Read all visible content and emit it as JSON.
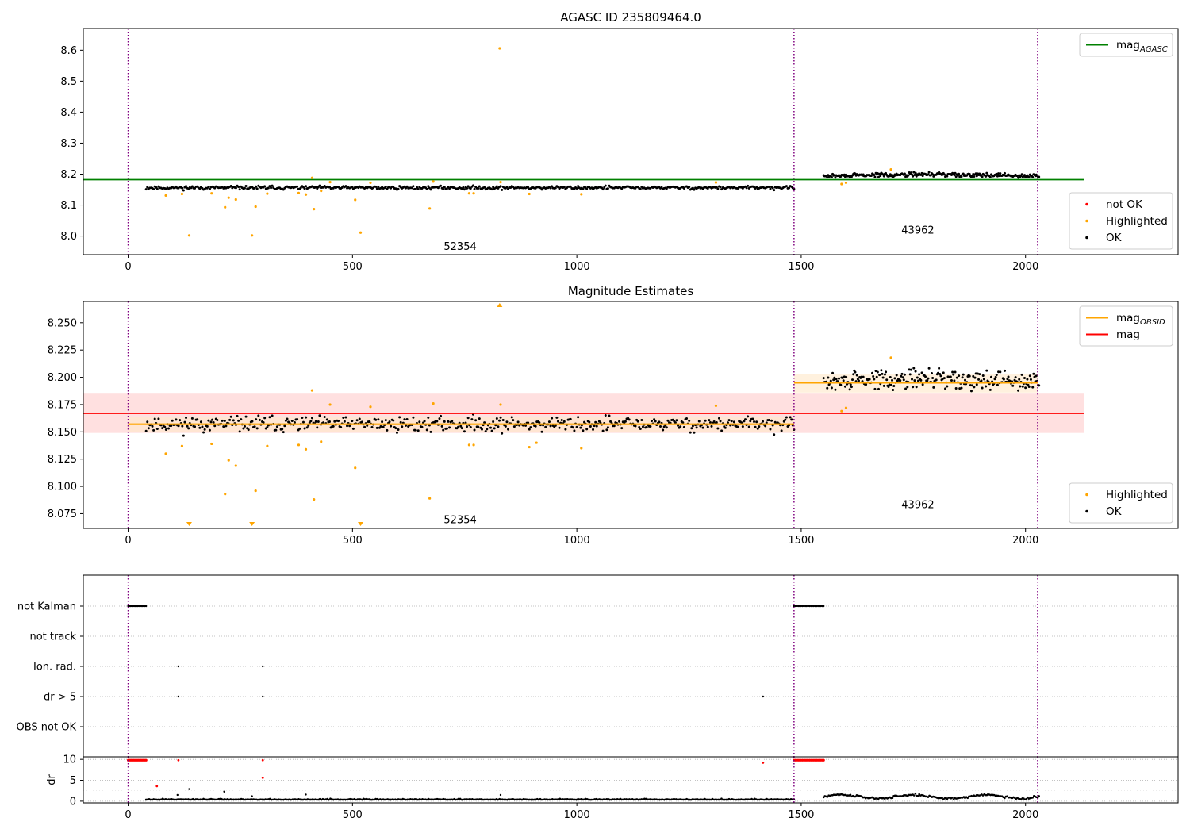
{
  "figure": {
    "colors": {
      "ok": "#000000",
      "highlighted": "#ffa500",
      "not_ok": "#ff0000",
      "mag_agasc": "#008000",
      "mag": "#ff0000",
      "mag_obsid": "#ffa500",
      "obsid_boundary": "#800080",
      "band_red": "#ffd6d6",
      "band_orange": "#ffe8c8",
      "grid": "#b0b0b0"
    }
  },
  "chart_data": [
    {
      "id": "top",
      "type": "scatter",
      "title": "AGASC ID 235809464.0",
      "xlim": [
        -100,
        2340
      ],
      "ylim": [
        7.94,
        8.67
      ],
      "xticks": [
        0,
        500,
        1000,
        1500,
        2000
      ],
      "yticks": [
        8.0,
        8.1,
        8.2,
        8.3,
        8.4,
        8.5,
        8.6
      ],
      "yfmt": 1,
      "obsid_boundaries": [
        0,
        1484,
        2027
      ],
      "obsid_labels": [
        {
          "text": "52354",
          "x": 740,
          "y": 7.965
        },
        {
          "text": "43962",
          "x": 1760,
          "y": 8.018
        }
      ],
      "hlines": [
        {
          "name": "mag_agasc",
          "y": 8.182,
          "x": [
            -100,
            2130
          ],
          "color": "#008000"
        }
      ],
      "ok_segments": [
        {
          "x0": 40,
          "x1": 1484,
          "n": 520,
          "base": 8.156,
          "amp": 0.0055,
          "seed": 11
        },
        {
          "x0": 1550,
          "x1": 2030,
          "n": 240,
          "base": 8.193,
          "amp": 0.0065,
          "seed": 29,
          "trend": 0.006
        }
      ],
      "highlighted": [
        [
          84,
          8.131
        ],
        [
          120,
          8.136
        ],
        [
          136,
          8.002
        ],
        [
          186,
          8.138
        ],
        [
          216,
          8.093
        ],
        [
          224,
          8.124
        ],
        [
          240,
          8.118
        ],
        [
          276,
          8.002
        ],
        [
          284,
          8.095
        ],
        [
          310,
          8.137
        ],
        [
          380,
          8.139
        ],
        [
          396,
          8.134
        ],
        [
          410,
          8.188
        ],
        [
          414,
          8.087
        ],
        [
          430,
          8.146
        ],
        [
          450,
          8.174
        ],
        [
          506,
          8.117
        ],
        [
          518,
          8.011
        ],
        [
          540,
          8.172
        ],
        [
          672,
          8.089
        ],
        [
          680,
          8.176
        ],
        [
          760,
          8.138
        ],
        [
          770,
          8.138
        ],
        [
          828,
          8.606
        ],
        [
          830,
          8.174
        ],
        [
          894,
          8.136
        ],
        [
          1010,
          8.135
        ],
        [
          1310,
          8.173
        ],
        [
          1590,
          8.168
        ],
        [
          1600,
          8.172
        ],
        [
          1700,
          8.215
        ]
      ],
      "not_ok": [],
      "legends": [
        {
          "position": "upper-right",
          "items": [
            {
              "label": "mag",
              "sub": "AGASC",
              "kind": "line",
              "color": "#008000"
            }
          ]
        },
        {
          "position": "lower-right",
          "items": [
            {
              "label": "not OK",
              "kind": "dot",
              "color": "#ff0000"
            },
            {
              "label": "Highlighted",
              "kind": "dot",
              "color": "#ffa500"
            },
            {
              "label": "OK",
              "kind": "dot",
              "color": "#000000"
            }
          ]
        }
      ]
    },
    {
      "id": "middle",
      "type": "scatter",
      "title": "Magnitude Estimates",
      "xlim": [
        -100,
        2340
      ],
      "ylim": [
        8.0615,
        8.2695
      ],
      "xticks": [
        0,
        500,
        1000,
        1500,
        2000
      ],
      "yticks": [
        8.075,
        8.1,
        8.125,
        8.15,
        8.175,
        8.2,
        8.225,
        8.25
      ],
      "yfmt": 3,
      "obsid_boundaries": [
        0,
        1484,
        2027
      ],
      "obsid_labels": [
        {
          "text": "52354",
          "x": 740,
          "y": 8.069
        },
        {
          "text": "43962",
          "x": 1760,
          "y": 8.083
        }
      ],
      "bands": [
        {
          "x": [
            -100,
            2130
          ],
          "y": [
            8.149,
            8.185
          ],
          "color": "#ffd6d6"
        },
        {
          "x": [
            0,
            1484
          ],
          "y": [
            8.15,
            8.164
          ],
          "color": "#ffe8c8"
        },
        {
          "x": [
            1484,
            2027
          ],
          "y": [
            8.186,
            8.203
          ],
          "color": "#ffe8c8"
        }
      ],
      "hlines": [
        {
          "name": "mag",
          "y": 8.167,
          "x": [
            -100,
            2130
          ],
          "color": "#ff0000"
        },
        {
          "name": "mag_obsid_1",
          "y": 8.157,
          "x": [
            0,
            1484
          ],
          "color": "#ffa500"
        },
        {
          "name": "mag_obsid_2",
          "y": 8.195,
          "x": [
            1484,
            2027
          ],
          "color": "#ffa500"
        }
      ],
      "ok_segments": [
        {
          "x0": 40,
          "x1": 1484,
          "n": 520,
          "base": 8.157,
          "amp": 0.0068,
          "seed": 11
        },
        {
          "x0": 1550,
          "x1": 2030,
          "n": 240,
          "base": 8.195,
          "amp": 0.0085,
          "seed": 29,
          "trend": 0.004
        }
      ],
      "highlighted": [
        [
          84,
          8.13
        ],
        [
          120,
          8.137
        ],
        [
          186,
          8.139
        ],
        [
          216,
          8.093
        ],
        [
          224,
          8.124
        ],
        [
          240,
          8.119
        ],
        [
          284,
          8.096
        ],
        [
          310,
          8.137
        ],
        [
          380,
          8.138
        ],
        [
          396,
          8.134
        ],
        [
          410,
          8.188
        ],
        [
          414,
          8.088
        ],
        [
          430,
          8.141
        ],
        [
          450,
          8.175
        ],
        [
          506,
          8.117
        ],
        [
          540,
          8.173
        ],
        [
          672,
          8.089
        ],
        [
          680,
          8.176
        ],
        [
          760,
          8.138
        ],
        [
          770,
          8.138
        ],
        [
          830,
          8.175
        ],
        [
          894,
          8.136
        ],
        [
          910,
          8.14
        ],
        [
          1010,
          8.135
        ],
        [
          1310,
          8.174
        ],
        [
          1590,
          8.169
        ],
        [
          1600,
          8.172
        ],
        [
          1700,
          8.218
        ]
      ],
      "off_scale_low": [
        136,
        276,
        518
      ],
      "off_scale_high": [
        828
      ],
      "legends": [
        {
          "position": "upper-right",
          "items": [
            {
              "label": "mag",
              "sub": "OBSID",
              "kind": "line",
              "color": "#ffa500"
            },
            {
              "label": "mag",
              "kind": "line",
              "color": "#ff0000"
            }
          ]
        },
        {
          "position": "lower-right",
          "items": [
            {
              "label": "Highlighted",
              "kind": "dot",
              "color": "#ffa500"
            },
            {
              "label": "OK",
              "kind": "dot",
              "color": "#000000"
            }
          ]
        }
      ]
    },
    {
      "id": "flags",
      "type": "scatter",
      "xlim": [
        -100,
        2340
      ],
      "rows": [
        "not Kalman",
        "not track",
        "Ion. rad.",
        "dr > 5",
        "OBS not OK"
      ],
      "obsid_boundaries": [
        0,
        1484,
        2027
      ],
      "flag_ranges": [
        {
          "row": "not Kalman",
          "x0": 0,
          "x1": 40,
          "n": 16
        },
        {
          "row": "not Kalman",
          "x0": 1484,
          "x1": 1550,
          "n": 22
        }
      ],
      "flag_points": [
        {
          "row": "Ion. rad.",
          "x": [
            112,
            300
          ]
        },
        {
          "row": "dr > 5",
          "x": [
            112,
            300,
            1415
          ]
        }
      ]
    },
    {
      "id": "dr",
      "type": "scatter",
      "ylabel": "dr",
      "xlim": [
        -100,
        2340
      ],
      "ylim": [
        -0.4,
        10.6
      ],
      "xticks": [
        0,
        500,
        1000,
        1500,
        2000
      ],
      "yticks": [
        0,
        5,
        10
      ],
      "obsid_boundaries": [
        0,
        1484,
        2027
      ],
      "red_clipped": [
        {
          "x0": 0,
          "x1": 40,
          "n": 16,
          "y": 9.8
        },
        {
          "x0": 1484,
          "x1": 1550,
          "n": 22,
          "y": 9.8
        }
      ],
      "red_points": [
        [
          64,
          3.6
        ],
        [
          112,
          9.8
        ],
        [
          300,
          9.8
        ],
        [
          300,
          5.6
        ],
        [
          1415,
          9.2
        ]
      ],
      "ok_segments": [
        {
          "x0": 40,
          "x1": 1484,
          "n": 430,
          "base": 0.35,
          "amp": 0.2,
          "seed": 5
        },
        {
          "x0": 1550,
          "x1": 2030,
          "n": 170,
          "base": 1.1,
          "amp": 0.55,
          "seed": 7
        }
      ],
      "ok_outliers": [
        [
          110,
          1.5
        ],
        [
          136,
          2.9
        ],
        [
          214,
          2.3
        ],
        [
          276,
          1.2
        ],
        [
          396,
          1.6
        ],
        [
          830,
          1.5
        ]
      ]
    }
  ]
}
